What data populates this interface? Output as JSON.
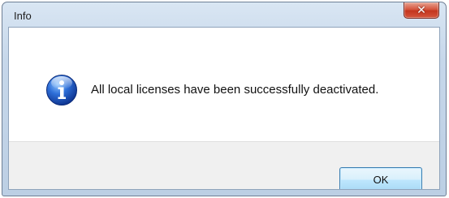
{
  "window": {
    "title": "Info",
    "close_glyph": "✕"
  },
  "message": {
    "text": "All local licenses have been successfully deactivated.",
    "icon": "info-icon"
  },
  "buttons": {
    "ok_label": "OK"
  },
  "colors": {
    "title_bar": "#c6d7ea",
    "close_button": "#c4361e",
    "footer": "#f0f0f0",
    "ok_button_border": "#3c7fb1"
  }
}
